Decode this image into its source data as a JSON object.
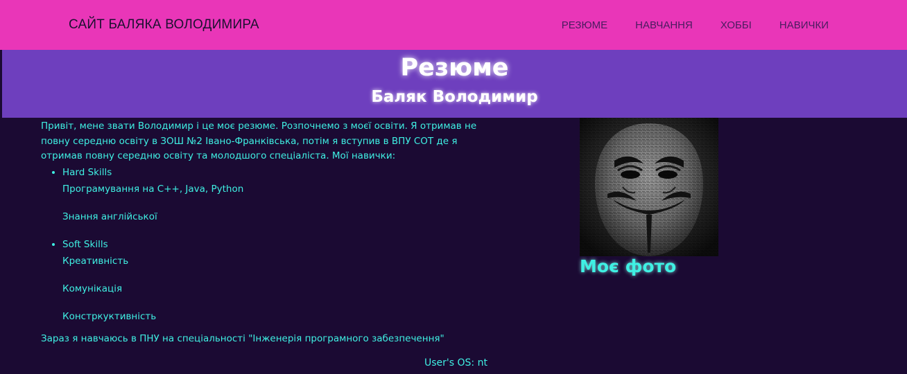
{
  "nav": {
    "brand": "САЙТ БАЛЯКА ВОЛОДИМИРА",
    "links": [
      "РЕЗЮМЕ",
      "НАВЧАННЯ",
      "ХОББІ",
      "НАВИЧКИ"
    ]
  },
  "hero": {
    "title": "Резюме",
    "subtitle": "Баляк Володимир"
  },
  "content": {
    "intro": "Привіт, мене звати Володимир і це моє резюме. Розпочнемо з моєї освіти. Я отримав не повну середню освіту в ЗОШ №2 Івано-Франківська, потім я вступив в ВПУ СОТ де я отримав повну середню освіту та молодшого спеціаліста. Мої навички:",
    "skills": [
      {
        "title": "Hard Skills",
        "items": [
          "Програмування на C++, Java, Python",
          "Знання англійської"
        ]
      },
      {
        "title": "Soft Skills",
        "items": [
          "Креативність",
          "Комунікація",
          "Констркуктивність"
        ]
      }
    ],
    "footer": "Зараз я навчаюсь в ПНУ на спеціальності \"Інженерія програмного забезпечення\""
  },
  "photo": {
    "caption": "Моє фото",
    "icon": "anonymous-mask-image"
  },
  "os": "User's OS: nt",
  "colors": {
    "navbar": "#e936b8",
    "hero": "#6e3fbe",
    "background": "#1b0a33",
    "accent_text": "#3ff0e3"
  }
}
